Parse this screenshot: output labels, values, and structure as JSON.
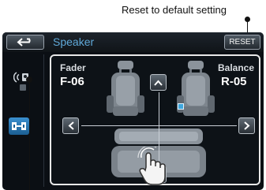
{
  "callouts": {
    "reset": "Reset to default setting"
  },
  "titlebar": {
    "title": "Speaker",
    "reset_label": "RESET"
  },
  "fader": {
    "label": "Fader",
    "value": "F-06"
  },
  "balance": {
    "label": "Balance",
    "value": "R-05"
  },
  "icons": {
    "back": "back-arrow-icon",
    "speaker": "speaker-icon",
    "fader_balance": "fader-balance-icon",
    "up": "chevron-up-icon",
    "down": "chevron-down-icon",
    "left": "chevron-left-icon",
    "right": "chevron-right-icon",
    "pointer": "hand-pointer-icon"
  },
  "colors": {
    "screen_bg": "#0b0f14",
    "title_text": "#5fa8d8",
    "accent_blue": "#3a8fcf",
    "marker": "#3fa7dd",
    "panel_border": "#e8e8e8"
  }
}
